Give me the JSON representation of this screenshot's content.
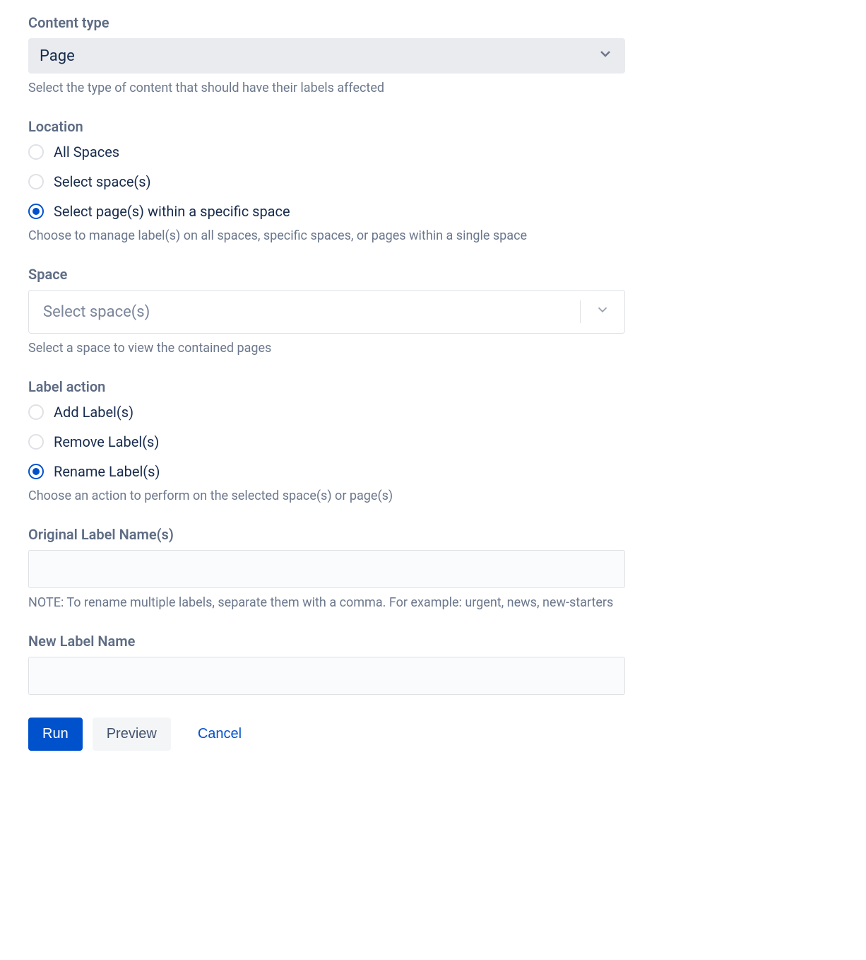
{
  "contentType": {
    "label": "Content type",
    "value": "Page",
    "help": "Select the type of content that should have their labels affected"
  },
  "location": {
    "label": "Location",
    "options": {
      "all": "All Spaces",
      "select": "Select space(s)",
      "pages": "Select page(s) within a specific space"
    },
    "help": "Choose to manage label(s) on all spaces, specific spaces, or pages within a single space"
  },
  "space": {
    "label": "Space",
    "placeholder": "Select space(s)",
    "help": "Select a space to view the contained pages"
  },
  "labelAction": {
    "label": "Label action",
    "options": {
      "add": "Add Label(s)",
      "remove": "Remove Label(s)",
      "rename": "Rename Label(s)"
    },
    "help": "Choose an action to perform on the selected space(s) or page(s)"
  },
  "originalLabel": {
    "label": "Original Label Name(s)",
    "help": "NOTE: To rename multiple labels, separate them with a comma. For example: urgent, news, new-starters"
  },
  "newLabel": {
    "label": "New Label Name"
  },
  "buttons": {
    "run": "Run",
    "preview": "Preview",
    "cancel": "Cancel"
  }
}
